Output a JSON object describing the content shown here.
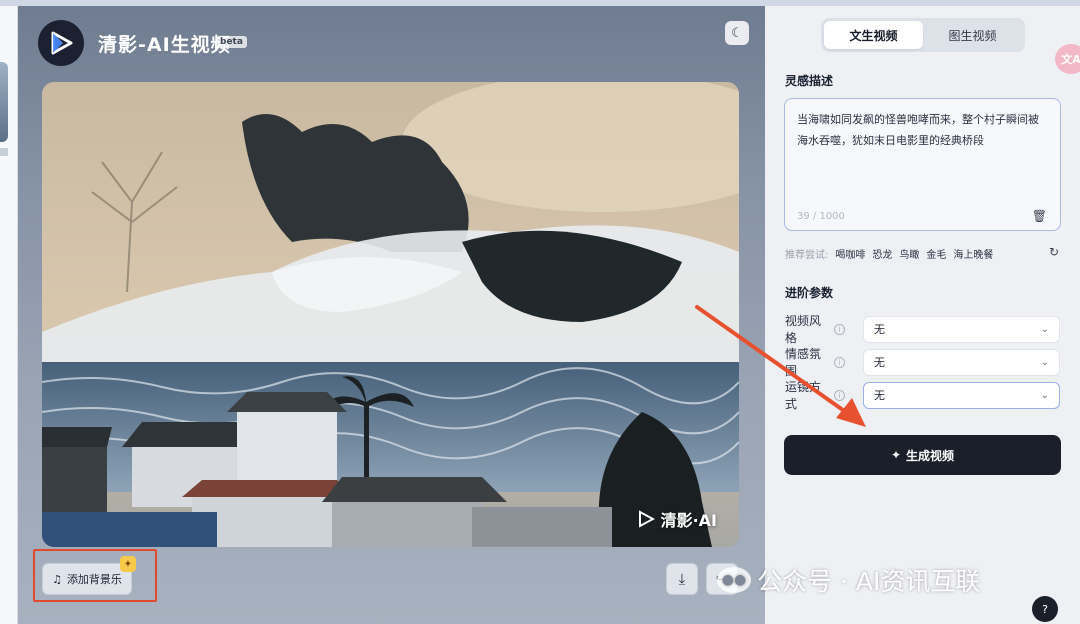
{
  "header": {
    "app_title": "清影-AI生视频",
    "beta_badge": "beta"
  },
  "video": {
    "watermark": "清影·AI"
  },
  "controls": {
    "music_label": "添加背景乐"
  },
  "overlay": {
    "wechat_watermark": "公众号 · AI资讯互联"
  },
  "panel": {
    "tabs": [
      {
        "label": "文生视频",
        "active": true
      },
      {
        "label": "图生视频",
        "active": false
      }
    ],
    "inspiration_title": "灵感描述",
    "prompt_text": "当海啸如同发飙的怪兽咆哮而来，整个村子瞬间被海水吞噬，犹如末日电影里的经典桥段",
    "char_count": "39 / 1000",
    "suggest_label": "推荐尝试:",
    "suggestions": [
      "喝咖啡",
      "恐龙",
      "鸟瞰",
      "金毛",
      "海上晚餐"
    ],
    "advanced_title": "进阶参数",
    "params": [
      {
        "label": "视频风格",
        "value": "无"
      },
      {
        "label": "情感氛围",
        "value": "无"
      },
      {
        "label": "运镜方式",
        "value": "无"
      }
    ],
    "generate_label": "生成视频"
  },
  "colors": {
    "accent_dark": "#1b1f29",
    "highlight_red": "#e04b2d",
    "focus_blue": "#a9b9ea"
  }
}
